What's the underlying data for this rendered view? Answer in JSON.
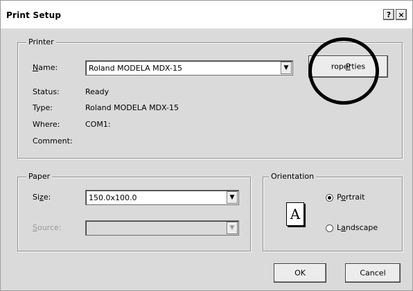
{
  "window": {
    "title": "Print Setup",
    "help_label": "?",
    "close_label": "×"
  },
  "printer": {
    "legend": "Printer",
    "name_label_u": "N",
    "name_label_rest": "ame:",
    "name_value": "Roland MODELA MDX-15",
    "properties_u": "P",
    "properties_rest": "roperties",
    "status_label": "Status:",
    "status_value": "Ready",
    "type_label": "Type:",
    "type_value": "Roland MODELA MDX-15",
    "where_label": "Where:",
    "where_value": "COM1:",
    "comment_label": "Comment:"
  },
  "paper": {
    "legend": "Paper",
    "size_label_pre": "Si",
    "size_label_u": "z",
    "size_label_rest": "e:",
    "size_value": "150.0x100.0",
    "source_label_u": "S",
    "source_label_rest": "ource:",
    "source_value": ""
  },
  "orientation": {
    "legend": "Orientation",
    "icon_letter": "A",
    "portrait_u": "o",
    "portrait_pre": "P",
    "portrait_rest": "rtrait",
    "landscape_pre": "L",
    "landscape_u": "a",
    "landscape_rest": "ndscape",
    "selected": "portrait"
  },
  "buttons": {
    "ok": "OK",
    "cancel": "Cancel"
  },
  "icons": {
    "dropdown": "chevron-down-icon",
    "page": "page-icon"
  }
}
